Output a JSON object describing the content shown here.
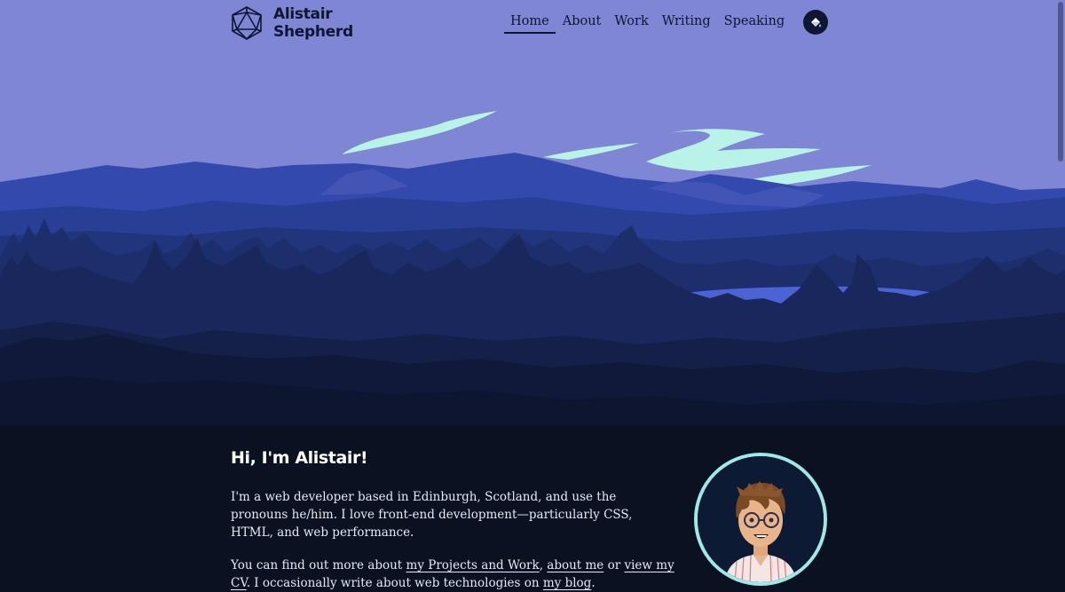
{
  "site": {
    "name_line1": "Alistair",
    "name_line2": "Shepherd"
  },
  "nav": {
    "items": [
      {
        "label": "Home",
        "active": true
      },
      {
        "label": "About",
        "active": false
      },
      {
        "label": "Work",
        "active": false
      },
      {
        "label": "Writing",
        "active": false
      },
      {
        "label": "Speaking",
        "active": false
      }
    ]
  },
  "theme_toggle": {
    "icon": "paint-bucket-icon"
  },
  "intro": {
    "heading": "Hi, I'm Alistair!",
    "p1": "I'm a web developer based in Edinburgh, Scotland, and use the pronouns he/him. I love front-end development—particularly CSS, HTML, and web performance.",
    "p2_before": "You can find out more about ",
    "p2_link1": "my Projects and Work",
    "p2_sep1": ", ",
    "p2_link2": "about me",
    "p2_sep2": " or ",
    "p2_link3": "view my CV",
    "p2_after": ". I occasionally write about web technologies on ",
    "p2_link4": "my blog",
    "p2_end": "."
  },
  "colors": {
    "sky": "#7f86d4",
    "cloud": "#b9f2e6",
    "text_dark": "#0e1633",
    "background": "#0a1120"
  }
}
